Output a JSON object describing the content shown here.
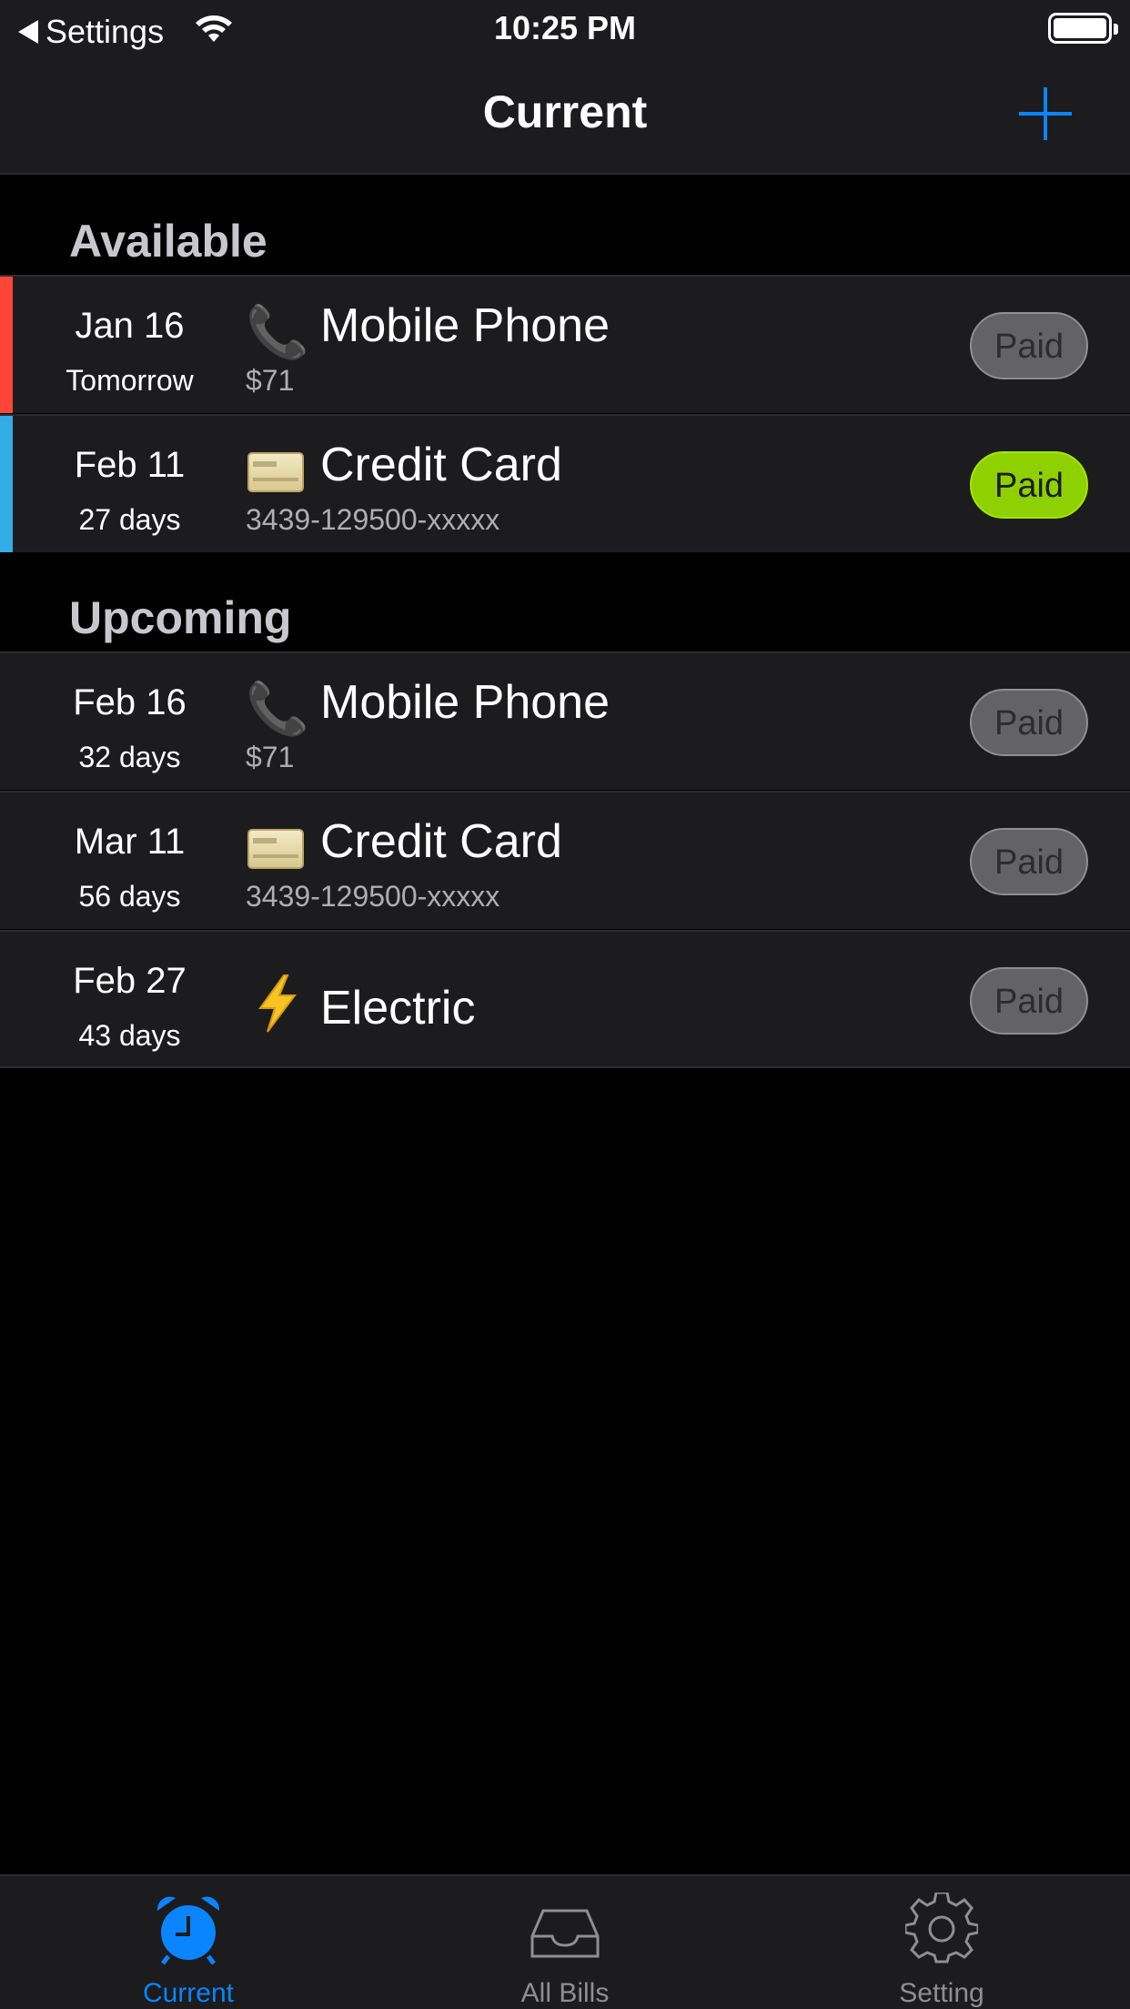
{
  "status_bar": {
    "back_label": "Settings",
    "time": "10:25 PM"
  },
  "nav": {
    "title": "Current"
  },
  "sections": {
    "available": {
      "title": "Available",
      "items": [
        {
          "date": "Jan 16",
          "relative": "Tomorrow",
          "icon": "phone-icon",
          "name": "Mobile Phone",
          "detail": "$71",
          "paid_label": "Paid",
          "paid": false,
          "stripe_color": "#ff453a"
        },
        {
          "date": "Feb 11",
          "relative": "27 days",
          "icon": "credit-card-icon",
          "name": "Credit Card",
          "detail": "3439-129500-xxxxx",
          "paid_label": "Paid",
          "paid": true,
          "stripe_color": "#32ade6"
        }
      ]
    },
    "upcoming": {
      "title": "Upcoming",
      "items": [
        {
          "date": "Feb 16",
          "relative": "32 days",
          "icon": "phone-icon",
          "name": "Mobile Phone",
          "detail": "$71",
          "paid_label": "Paid",
          "paid": false
        },
        {
          "date": "Mar 11",
          "relative": "56 days",
          "icon": "credit-card-icon",
          "name": "Credit Card",
          "detail": "3439-129500-xxxxx",
          "paid_label": "Paid",
          "paid": false
        },
        {
          "date": "Feb 27",
          "relative": "43 days",
          "icon": "lightning-icon",
          "name": "Electric",
          "detail": "",
          "paid_label": "Paid",
          "paid": false
        }
      ]
    }
  },
  "tabs": [
    {
      "label": "Current",
      "icon": "alarm-clock-icon",
      "active": true
    },
    {
      "label": "All Bills",
      "icon": "inbox-tray-icon",
      "active": false
    },
    {
      "label": "Setting",
      "icon": "gear-icon",
      "active": false
    }
  ],
  "colors": {
    "accent": "#0a84ff",
    "paid_active": "#8fd100",
    "overdue_stripe": "#ff453a",
    "due_stripe": "#32ade6"
  }
}
